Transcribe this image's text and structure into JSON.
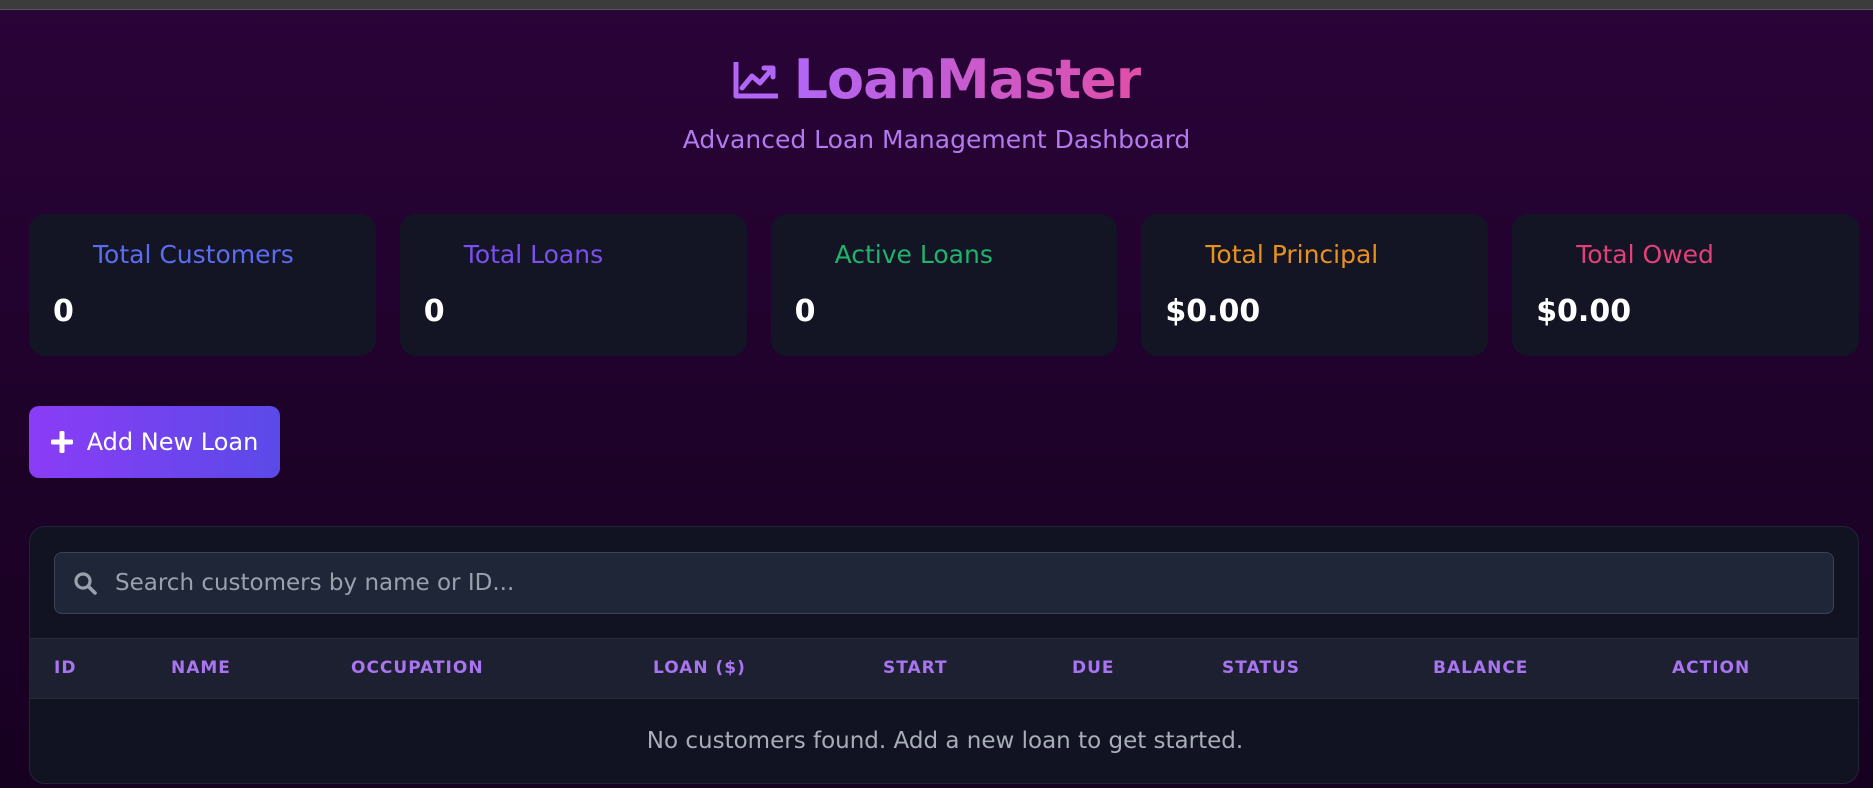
{
  "header": {
    "title": "LoanMaster",
    "subtitle": "Advanced Loan Management Dashboard",
    "icon": "chart-line-icon"
  },
  "stats": [
    {
      "label": "Total Customers",
      "value": "0",
      "color": "#5b6cf0"
    },
    {
      "label": "Total Loans",
      "value": "0",
      "color": "#7b4ff0"
    },
    {
      "label": "Active Loans",
      "value": "0",
      "color": "#1fb36c"
    },
    {
      "label": "Total Principal",
      "value": "$0.00",
      "color": "#e8921d"
    },
    {
      "label": "Total Owed",
      "value": "$0.00",
      "color": "#e33f78"
    }
  ],
  "actions": {
    "add_loan_label": "Add New Loan",
    "add_loan_icon": "plus-icon"
  },
  "search": {
    "placeholder": "Search customers by name or ID...",
    "value": "",
    "icon": "search-icon"
  },
  "table": {
    "columns": [
      "ID",
      "NAME",
      "OCCUPATION",
      "LOAN ($)",
      "START",
      "DUE",
      "STATUS",
      "BALANCE",
      "ACTION"
    ],
    "empty_message": "No customers found. Add a new loan to get started."
  },
  "colors": {
    "accent_purple": "#8b3cf6",
    "accent_indigo": "#5a4ae8",
    "header_text": "#a874f0"
  }
}
